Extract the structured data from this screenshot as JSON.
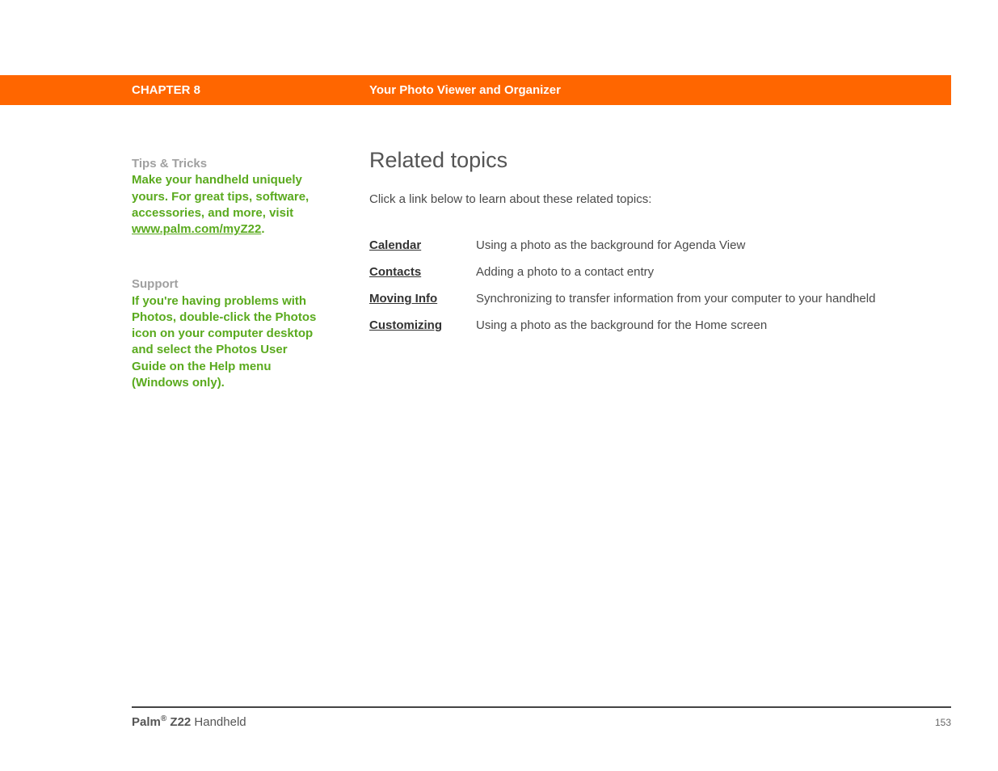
{
  "header": {
    "chapter": "CHAPTER 8",
    "title": "Your Photo Viewer and Organizer"
  },
  "sidebar": {
    "tips": {
      "heading": "Tips & Tricks",
      "text_before_link": "Make your handheld uniquely yours. For great tips, software, accessories, and more, visit ",
      "link_text": "www.palm.com/myZ22",
      "text_after_link": "."
    },
    "support": {
      "heading": "Support",
      "text": "If you're having problems with Photos, double-click the Photos icon on your computer desktop and select the Photos User Guide on the Help menu (Windows only)."
    }
  },
  "main": {
    "heading": "Related topics",
    "intro": "Click a link below to learn about these related topics:",
    "topics": [
      {
        "link": "Calendar",
        "desc": "Using a photo as the background for Agenda View"
      },
      {
        "link": "Contacts",
        "desc": "Adding a photo to a contact entry"
      },
      {
        "link": "Moving Info",
        "desc": "Synchronizing to transfer information from your computer to your handheld"
      },
      {
        "link": "Customizing",
        "desc": "Using a photo as the background for the Home screen"
      }
    ]
  },
  "footer": {
    "brand": "Palm",
    "reg": "®",
    "model": " Z22",
    "product": " Handheld",
    "page": "153"
  }
}
